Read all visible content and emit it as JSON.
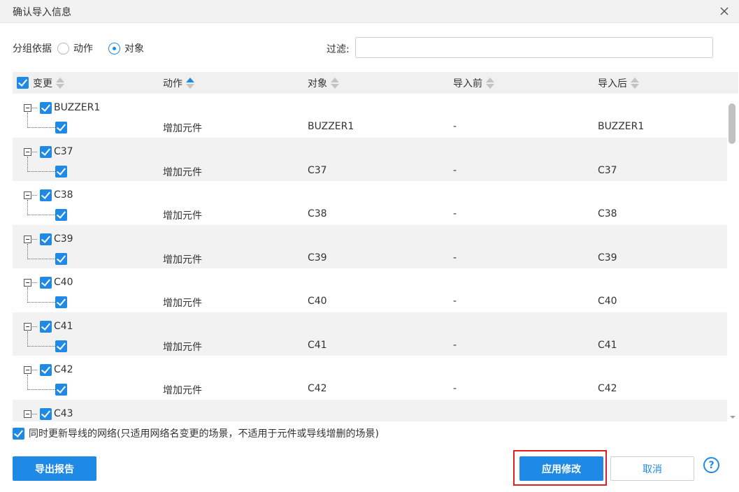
{
  "dialog": {
    "title": "确认导入信息"
  },
  "grouping": {
    "label": "分组依据",
    "options": [
      {
        "label": "动作",
        "selected": false
      },
      {
        "label": "对象",
        "selected": true
      }
    ]
  },
  "filter": {
    "label": "过滤:",
    "value": "",
    "placeholder": ""
  },
  "table": {
    "columns": [
      {
        "label": "变更",
        "sort": "none"
      },
      {
        "label": "动作",
        "sort": "asc"
      },
      {
        "label": "对象",
        "sort": "none"
      },
      {
        "label": "导入前",
        "sort": "none"
      },
      {
        "label": "导入后",
        "sort": "none"
      }
    ],
    "rows": [
      {
        "name": "BUZZER1",
        "action": "增加元件",
        "object": "BUZZER1",
        "before": "-",
        "after": "BUZZER1"
      },
      {
        "name": "C37",
        "action": "增加元件",
        "object": "C37",
        "before": "-",
        "after": "C37"
      },
      {
        "name": "C38",
        "action": "增加元件",
        "object": "C38",
        "before": "-",
        "after": "C38"
      },
      {
        "name": "C39",
        "action": "增加元件",
        "object": "C39",
        "before": "-",
        "after": "C39"
      },
      {
        "name": "C40",
        "action": "增加元件",
        "object": "C40",
        "before": "-",
        "after": "C40"
      },
      {
        "name": "C41",
        "action": "增加元件",
        "object": "C41",
        "before": "-",
        "after": "C41"
      },
      {
        "name": "C42",
        "action": "增加元件",
        "object": "C42",
        "before": "-",
        "after": "C42"
      },
      {
        "name": "C43",
        "action": "",
        "object": "",
        "before": "",
        "after": ""
      }
    ]
  },
  "update_nets_option": {
    "label": "同时更新导线的网络(只适用网络名变更的场景，不适用于元件或导线增删的场景)",
    "checked": true
  },
  "buttons": {
    "export": "导出报告",
    "apply": "应用修改",
    "cancel": "取消",
    "help": "?"
  },
  "colors": {
    "accent": "#1e8ae6",
    "highlight": "#e02020",
    "header_bg": "#f0f0f0",
    "row_alt_bg": "#f2f2f2"
  }
}
